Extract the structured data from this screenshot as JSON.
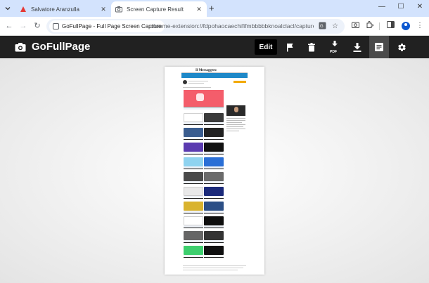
{
  "tabs": [
    {
      "title": "Salvatore Aranzulla",
      "active": false
    },
    {
      "title": "Screen Capture Result",
      "active": true
    }
  ],
  "toolbar": {
    "chip_label": "GoFullPage - Full Page Screen Capture",
    "url": "chrome-extension://fdpohaocaechififmbbbbbknoalclacl/capture.html?id=1..."
  },
  "app": {
    "brand": "GoFullPage",
    "edit_label": "Edit",
    "pdf_label": "PDF"
  },
  "captured_page": {
    "logo": "Il Messaggero"
  },
  "colors": {
    "tabstrip": "#d3e3fd",
    "header": "#212121",
    "accent": "#1e88c8",
    "profile": "#0b57d0"
  },
  "icons": [
    "chevron-down-icon",
    "aranzulla-logo-icon",
    "camera-icon",
    "close-icon",
    "plus-icon",
    "minimize-icon",
    "maximize-icon",
    "back-icon",
    "forward-icon",
    "reload-icon",
    "translate-icon",
    "star-icon",
    "screenshot-icon",
    "extensions-icon",
    "side-panel-icon",
    "profile-icon",
    "menu-dots-icon",
    "flag-icon",
    "trash-icon",
    "download-pdf-icon",
    "download-icon",
    "notes-icon",
    "gear-icon"
  ]
}
